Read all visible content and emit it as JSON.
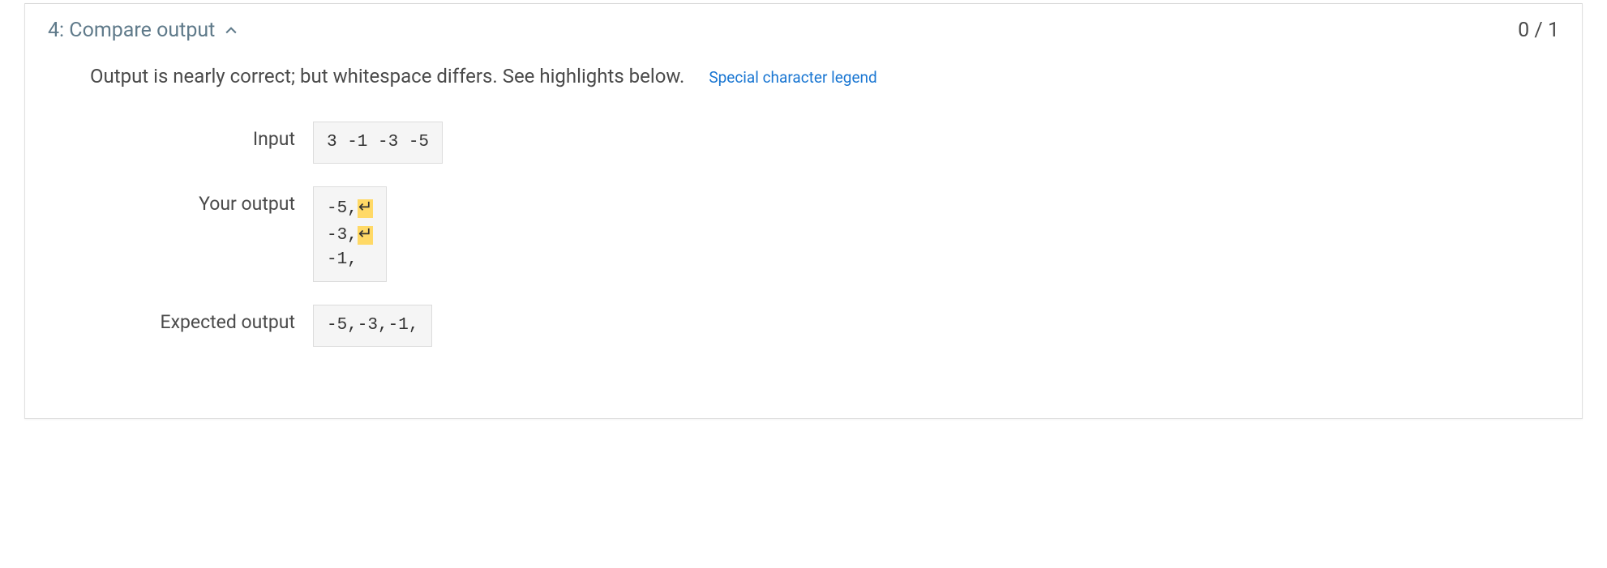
{
  "header": {
    "title": "4: Compare output",
    "score": "0 / 1"
  },
  "body": {
    "message": "Output is nearly correct; but whitespace differs. See highlights below.",
    "legend_link": "Special character legend",
    "rows": {
      "input": {
        "label": "Input",
        "value": "3 -1 -3 -5"
      },
      "your_output": {
        "label": "Your output",
        "lines": [
          {
            "text": "-5,",
            "highlighted_newline": true
          },
          {
            "text": "-3,",
            "highlighted_newline": true
          },
          {
            "text": "-1,",
            "highlighted_newline": false
          }
        ],
        "newline_glyph": "↵"
      },
      "expected_output": {
        "label": "Expected output",
        "value": "-5,-3,-1,"
      }
    }
  }
}
